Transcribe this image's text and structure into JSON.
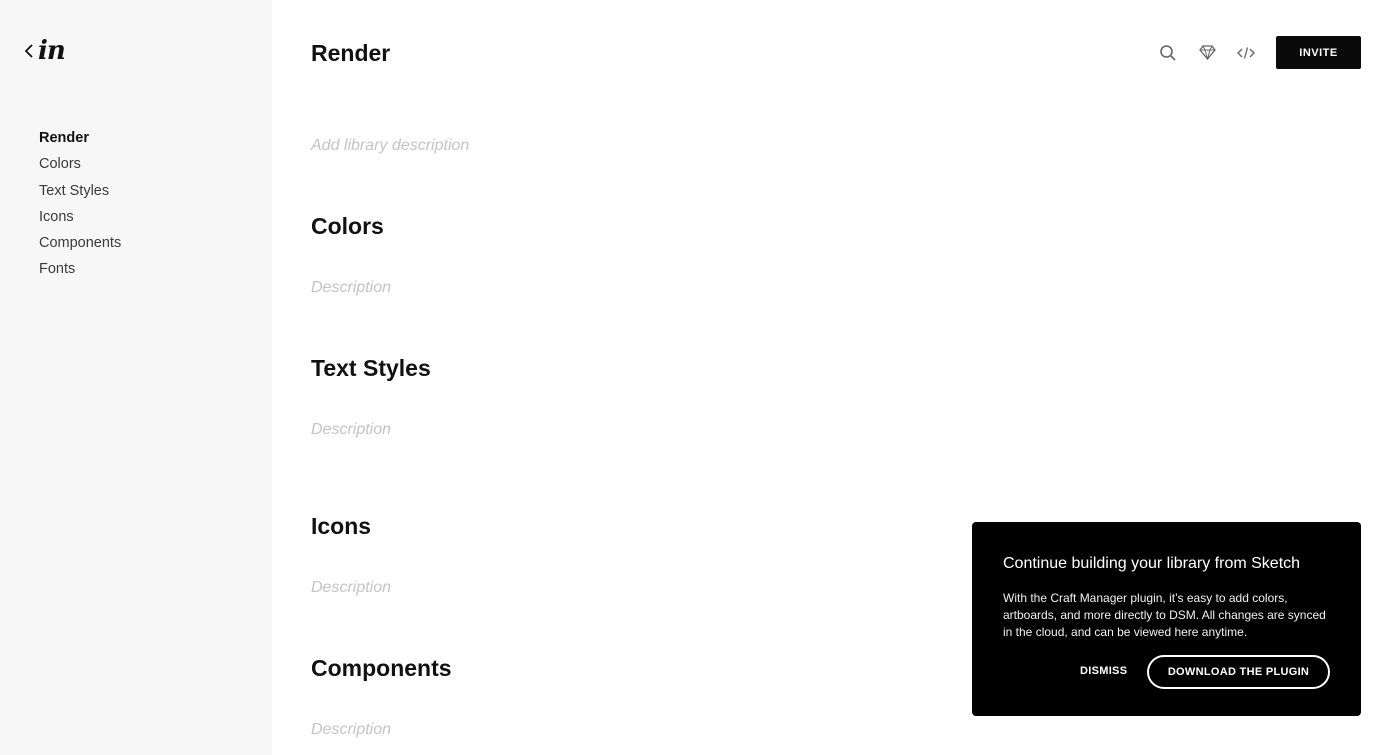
{
  "brand": {
    "logo_text": "in",
    "back_icon": "chevron-left-icon"
  },
  "sidebar": {
    "items": [
      {
        "label": "Render",
        "active": true
      },
      {
        "label": "Colors"
      },
      {
        "label": "Text Styles"
      },
      {
        "label": "Icons"
      },
      {
        "label": "Components"
      },
      {
        "label": "Fonts"
      }
    ]
  },
  "header": {
    "title": "Render",
    "icons": [
      "search-icon",
      "sketch-diamond-icon",
      "code-icon"
    ],
    "invite_label": "INVITE"
  },
  "library": {
    "description_placeholder": "Add library description"
  },
  "sections": [
    {
      "title": "Colors",
      "description": "Description"
    },
    {
      "title": "Text Styles",
      "description": "Description"
    },
    {
      "title": "Icons",
      "description": "Description"
    },
    {
      "title": "Components",
      "description": "Description"
    }
  ],
  "toast": {
    "title": "Continue building your library from Sketch",
    "body": "With the Craft Manager plugin, it’s easy to add colors, artboards, and more directly to DSM. All changes are synced in the cloud, and can be viewed here anytime.",
    "dismiss_label": "DISMISS",
    "download_label": "DOWNLOAD THE PLUGIN"
  },
  "colors": {
    "sidebar_bg": "#f7f7f7",
    "accent": "#0a0a0a",
    "placeholder": "#c4c4c4"
  }
}
